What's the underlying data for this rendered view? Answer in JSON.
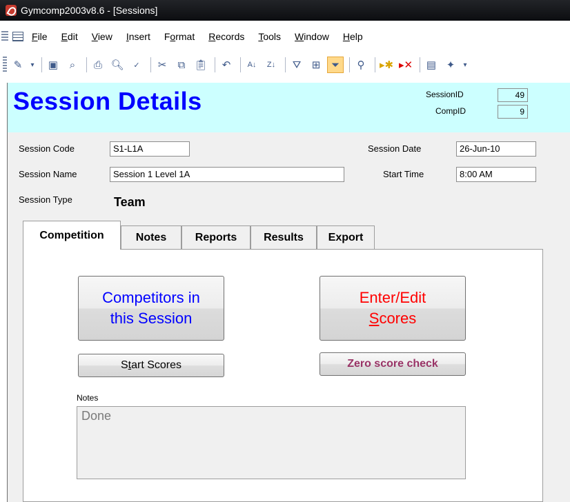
{
  "window": {
    "title": "Gymcomp2003v8.6 - [Sessions]"
  },
  "menu": {
    "items": [
      {
        "key": "F",
        "rest": "ile"
      },
      {
        "key": "E",
        "rest": "dit"
      },
      {
        "key": "V",
        "rest": "iew"
      },
      {
        "key": "I",
        "rest": "nsert"
      },
      {
        "pre": "F",
        "key": "o",
        "rest": "rmat"
      },
      {
        "key": "R",
        "rest": "ecords"
      },
      {
        "key": "T",
        "rest": "ools"
      },
      {
        "key": "W",
        "rest": "indow"
      },
      {
        "key": "H",
        "rest": "elp"
      }
    ]
  },
  "toolbar": {
    "icons": [
      "design-view-icon",
      "save-icon",
      "search-file-icon",
      "print-icon",
      "print-preview-icon",
      "spelling-icon",
      "cut-icon",
      "copy-icon",
      "paste-icon",
      "undo-icon",
      "sort-ascending-icon",
      "sort-descending-icon",
      "filter-by-selection-icon",
      "filter-by-form-icon",
      "toggle-filter-icon",
      "find-icon",
      "new-record-icon",
      "delete-record-icon",
      "database-window-icon",
      "new-object-icon"
    ]
  },
  "header": {
    "title": "Session Details",
    "session_id_label": "SessionID",
    "session_id": "49",
    "comp_id_label": "CompID",
    "comp_id": "9",
    "band_color": "#ccffff",
    "title_color": "#0000ff"
  },
  "fields": {
    "session_code_label": "Session Code",
    "session_code": "S1-L1A",
    "session_name_label": "Session Name",
    "session_name": "Session 1 Level 1A",
    "session_type_label": "Session Type",
    "session_type": "Team",
    "session_date_label": "Session Date",
    "session_date": "26-Jun-10",
    "start_time_label": "Start Time",
    "start_time": "8:00 AM"
  },
  "tabs": [
    {
      "label": "Competition",
      "active": true
    },
    {
      "label": "Notes",
      "active": false
    },
    {
      "label": "Reports",
      "active": false
    },
    {
      "label": "Results",
      "active": false
    },
    {
      "label": "Export",
      "active": false
    }
  ],
  "competition": {
    "competitors_line1": "Competitors in",
    "competitors_line2": "this Session",
    "competitors_color": "#0000ff",
    "enter_line1": "Enter/Edit",
    "enter_line2_key": "S",
    "enter_line2_rest": "cores",
    "enter_color": "#ff0000",
    "start_key_pre": "S",
    "start_key": "t",
    "start_rest": "art Scores",
    "zero_check": "Zero score check",
    "zero_color": "#993366",
    "notes_label": "Notes",
    "notes_value": "Done"
  }
}
